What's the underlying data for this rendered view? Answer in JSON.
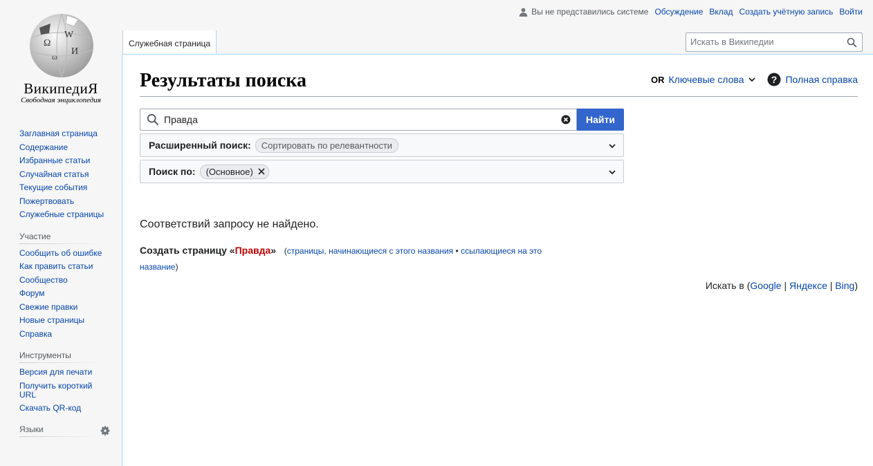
{
  "logo": {
    "wordmark": "ВикипедиЯ",
    "tagline": "Свободная энциклопедия"
  },
  "personal": {
    "anon": "Вы не представились системе",
    "links": [
      "Обсуждение",
      "Вклад",
      "Создать учётную запись",
      "Войти"
    ]
  },
  "tab": {
    "label": "Служебная страница"
  },
  "header_search": {
    "placeholder": "Искать в Википедии"
  },
  "sidebar": {
    "main": [
      "Заглавная страница",
      "Содержание",
      "Избранные статьи",
      "Случайная статья",
      "Текущие события",
      "Пожертвовать",
      "Служебные страницы"
    ],
    "participation": {
      "heading": "Участие",
      "items": [
        "Сообщить об ошибке",
        "Как править статьи",
        "Сообщество",
        "Форум",
        "Свежие правки",
        "Новые страницы",
        "Справка"
      ]
    },
    "tools": {
      "heading": "Инструменты",
      "items": [
        "Версия для печати",
        "Получить короткий URL",
        "Скачать QR-код"
      ]
    },
    "languages": {
      "heading": "Языки"
    }
  },
  "page": {
    "title": "Результаты поиска",
    "or_label": "OR",
    "keywords": "Ключевые слова",
    "help": "Полная справка"
  },
  "search": {
    "value": "Правда",
    "button": "Найти"
  },
  "advanced": {
    "label": "Расширенный поиск:",
    "chip": "Сортировать по релевантности"
  },
  "namespaces": {
    "label": "Поиск по:",
    "chip": "(Основное)"
  },
  "results": {
    "none": "Соответствий запросу не найдено.",
    "create_prefix": "Создать страницу «",
    "create_link": "Правда",
    "create_suffix": "»",
    "paren_open": "(",
    "starts_link": "страницы, начинающиеся с этого названия",
    "bullet": " • ",
    "links_link": "ссылающиеся на это название",
    "paren_close": ")"
  },
  "external": {
    "prefix": "Искать в (",
    "google": "Google",
    "sep": " | ",
    "yandex": "Яндексе",
    "bing": "Bing",
    "suffix": ")"
  }
}
